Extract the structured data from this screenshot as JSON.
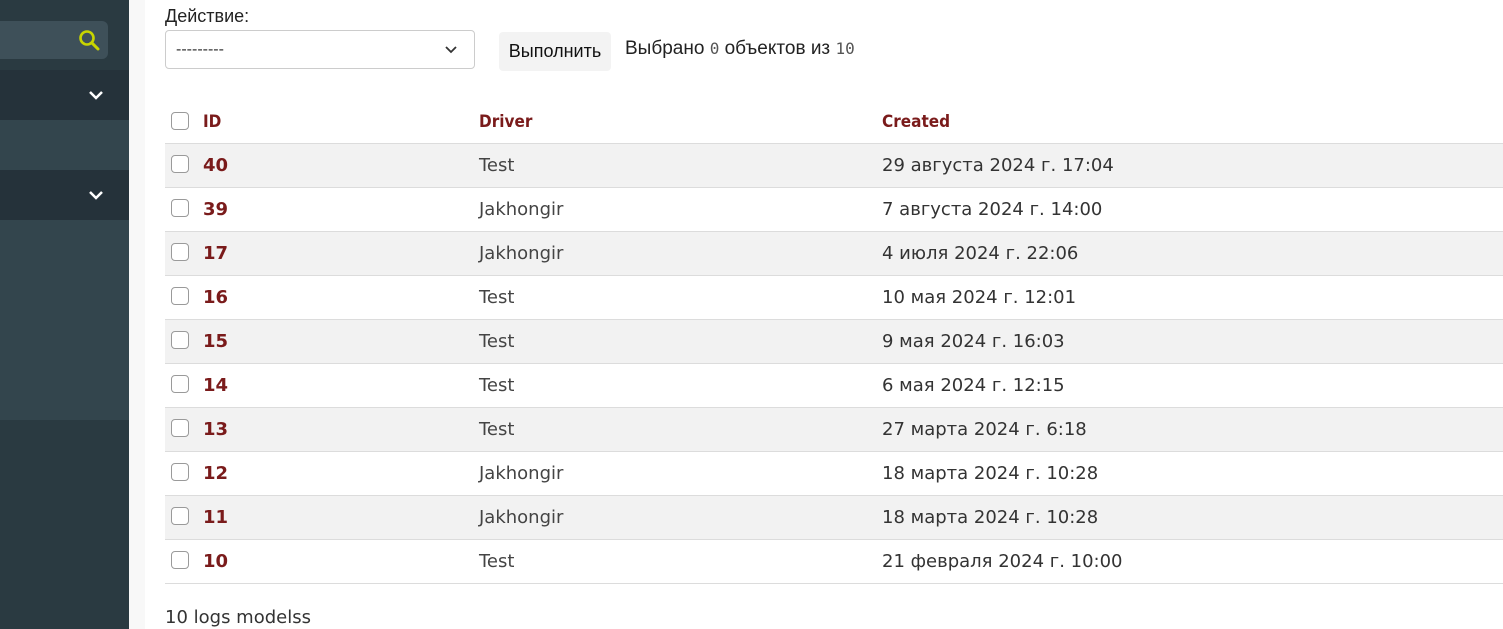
{
  "action": {
    "label": "Действие:",
    "selected_value": "---------",
    "run_button": "Выполнить",
    "selection": {
      "prefix": "Выбрано",
      "selected": "0",
      "middle": "объектов из",
      "total": "10"
    }
  },
  "table": {
    "columns": {
      "id": "ID",
      "driver": "Driver",
      "created": "Created"
    },
    "rows": [
      {
        "id": "40",
        "driver": "Test",
        "created": "29 августа 2024 г. 17:04"
      },
      {
        "id": "39",
        "driver": "Jakhongir",
        "created": "7 августа 2024 г. 14:00"
      },
      {
        "id": "17",
        "driver": "Jakhongir",
        "created": "4 июля 2024 г. 22:06"
      },
      {
        "id": "16",
        "driver": "Test",
        "created": "10 мая 2024 г. 12:01"
      },
      {
        "id": "15",
        "driver": "Test",
        "created": "9 мая 2024 г. 16:03"
      },
      {
        "id": "14",
        "driver": "Test",
        "created": "6 мая 2024 г. 12:15"
      },
      {
        "id": "13",
        "driver": "Test",
        "created": "27 марта 2024 г. 6:18"
      },
      {
        "id": "12",
        "driver": "Jakhongir",
        "created": "18 марта 2024 г. 10:28"
      },
      {
        "id": "11",
        "driver": "Jakhongir",
        "created": "18 марта 2024 г. 10:28"
      },
      {
        "id": "10",
        "driver": "Test",
        "created": "21 февраля 2024 г. 10:00"
      }
    ]
  },
  "footer": {
    "count_text": "10 logs modelss"
  },
  "icons": {
    "search": "search-icon",
    "dropdown": "chevron-down-icon",
    "group_toggle": "chevron-down-icon"
  },
  "colors": {
    "accent": "#7a1b1b",
    "search_icon": "#c8d400",
    "sidebar": "#2a3a41"
  }
}
